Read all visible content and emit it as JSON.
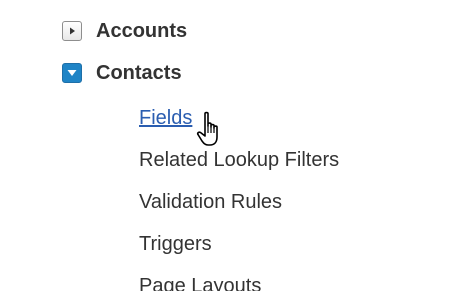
{
  "tree": {
    "nodes": [
      {
        "label": "Accounts",
        "state": "collapsed",
        "icon": "expand-arrow-icon"
      },
      {
        "label": "Contacts",
        "state": "expanded",
        "icon": "collapse-arrow-icon",
        "children": [
          {
            "label": "Fields",
            "type": "link",
            "hovered": true
          },
          {
            "label": "Related Lookup Filters"
          },
          {
            "label": "Validation Rules"
          },
          {
            "label": "Triggers"
          },
          {
            "label": "Page Layouts"
          }
        ]
      }
    ]
  },
  "colors": {
    "text": "#333333",
    "link": "#2a5db0",
    "expanded_toggle": "#1f84c6"
  },
  "cursor": {
    "icon": "hand-pointer-icon"
  }
}
